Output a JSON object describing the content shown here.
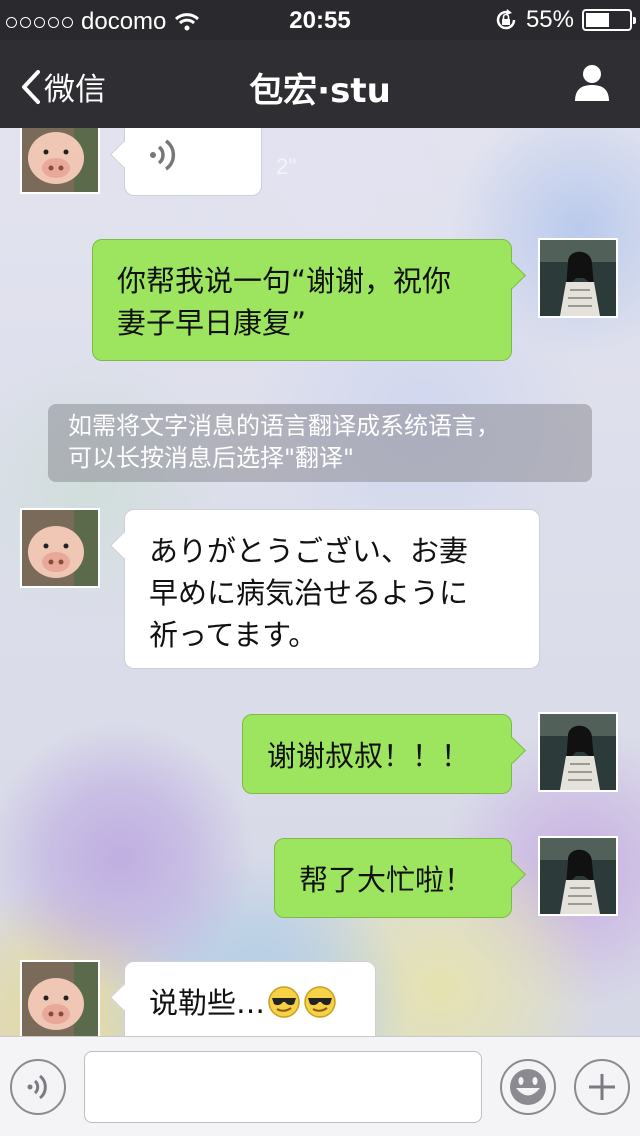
{
  "status_bar": {
    "carrier": "docomo",
    "time": "20:55",
    "battery_percent": "55%",
    "battery_level": 0.55
  },
  "nav": {
    "back_label": "微信",
    "title": "包宏·stu"
  },
  "messages": [
    {
      "sender": "contact",
      "type": "voice",
      "duration": "2''"
    },
    {
      "sender": "me",
      "type": "text",
      "lines": [
        "你帮我说一句“谢谢，祝你",
        "妻子早日康复”"
      ]
    },
    {
      "sender": "system",
      "type": "tip",
      "lines": [
        "如需将文字消息的语言翻译成系统语言，",
        "可以长按消息后选择\"翻译\""
      ]
    },
    {
      "sender": "contact",
      "type": "text",
      "lines": [
        "ありがとうござい、お妻",
        "早めに病気治せるように",
        "祈ってます。"
      ]
    },
    {
      "sender": "me",
      "type": "text",
      "lines": [
        "谢谢叔叔！！！"
      ]
    },
    {
      "sender": "me",
      "type": "text",
      "lines": [
        "帮了大忙啦！"
      ]
    },
    {
      "sender": "contact",
      "type": "text",
      "lines": [
        "说勒些…"
      ],
      "emoji": [
        "sunglasses-face",
        "sunglasses-face"
      ]
    }
  ],
  "input_bar": {
    "text_value": "",
    "icons": [
      "voice-icon",
      "emoji-icon",
      "plus-icon"
    ]
  },
  "colors": {
    "nav_background": "#2f2f33",
    "outgoing_bubble": "#9ee55f",
    "incoming_bubble": "#ffffff"
  }
}
